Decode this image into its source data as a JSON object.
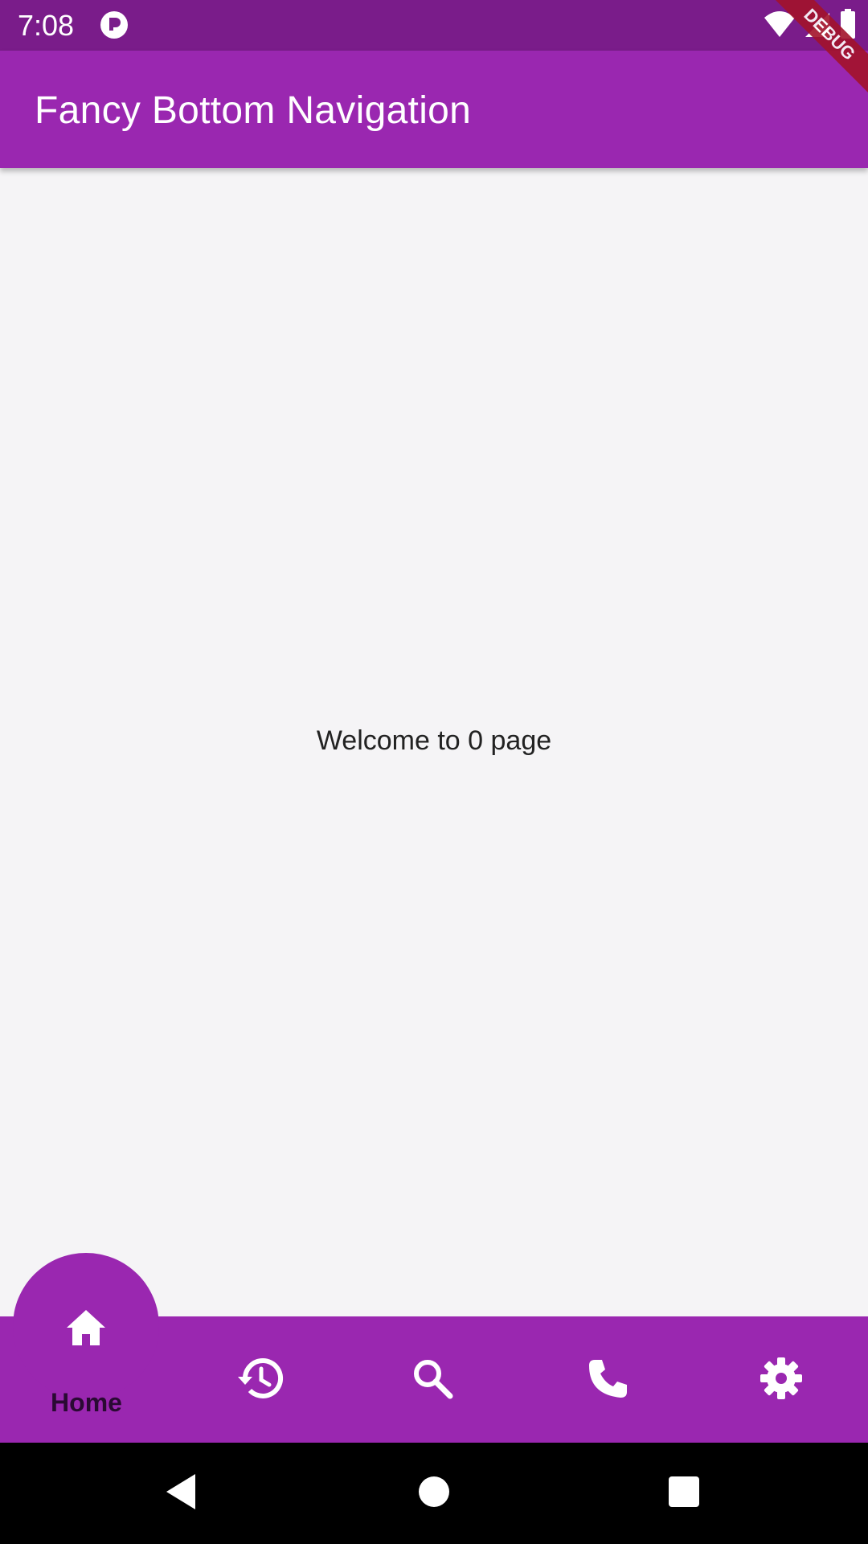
{
  "status_bar": {
    "time": "7:08"
  },
  "app_bar": {
    "title": "Fancy Bottom Navigation"
  },
  "debug_banner": {
    "label": "DEBUG"
  },
  "content": {
    "message": "Welcome to 0 page"
  },
  "bottom_nav": {
    "selected_index": 0,
    "items": [
      {
        "label": "Home",
        "icon": "home-icon"
      },
      {
        "label": "",
        "icon": "history-icon"
      },
      {
        "label": "",
        "icon": "search-icon"
      },
      {
        "label": "",
        "icon": "phone-icon"
      },
      {
        "label": "",
        "icon": "settings-icon"
      }
    ]
  },
  "colors": {
    "primary": "#9a27b0",
    "status_bar": "#7a1c8a",
    "background": "#f5f4f6",
    "debug_banner": "#a3132b"
  }
}
